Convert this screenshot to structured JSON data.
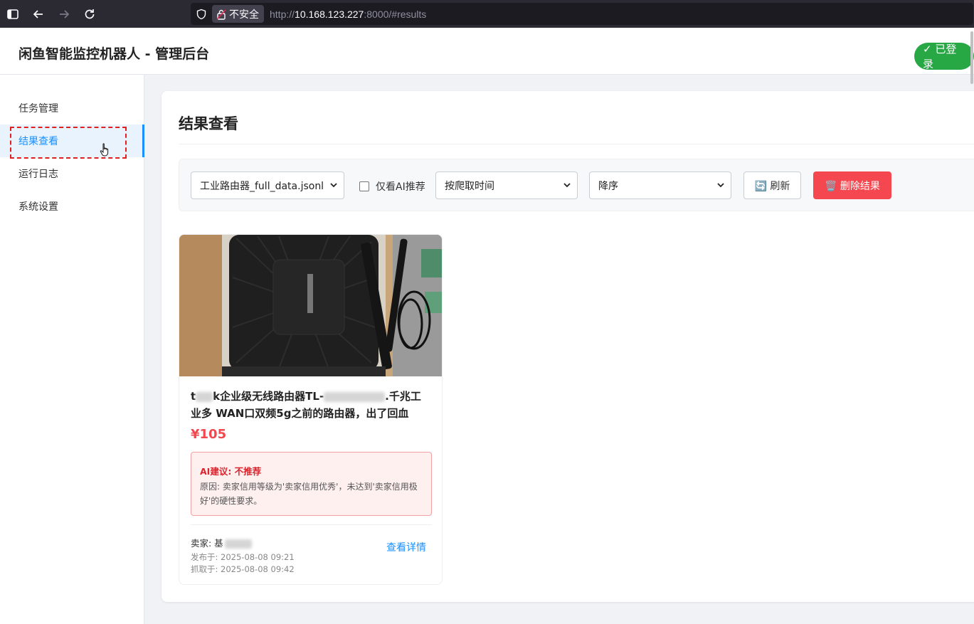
{
  "browser": {
    "security_label": "不安全",
    "url_prefix": "http://",
    "url_host": "10.168.123.227",
    "url_rest": ":8000/#results"
  },
  "header": {
    "title": "闲鱼智能监控机器人 - 管理后台",
    "login_status": "✓ 已登录"
  },
  "sidebar": {
    "items": [
      {
        "label": "任务管理",
        "active": false
      },
      {
        "label": "结果查看",
        "active": true
      },
      {
        "label": "运行日志",
        "active": false
      },
      {
        "label": "系统设置",
        "active": false
      }
    ]
  },
  "main": {
    "title": "结果查看",
    "toolbar": {
      "file_select": "工业路由器_full_data.jsonl",
      "ai_only_label": "仅看AI推荐",
      "ai_only_checked": false,
      "sort_field": "按爬取时间",
      "sort_order": "降序",
      "refresh_label": "🔄 刷新",
      "delete_label": "🗑️ 删除结果"
    },
    "results": [
      {
        "title_line1_a": "t",
        "title_line1_b": "k企业级无线路由器TL-",
        "title_line1_c": ".千兆工",
        "title_line2": "业多 WAN口双频5g之前的路由器，出了回血",
        "price": "¥105",
        "ai_verdict": "AI建议: 不推荐",
        "ai_reason": "原因: 卖家信用等级为'卖家信用优秀'，未达到'卖家信用极好'的硬性要求。",
        "seller_prefix": "卖家: 基",
        "published": "发布于: 2025-08-08 09:21",
        "fetched": "抓取于: 2025-08-08 09:42",
        "detail_link": "查看详情"
      }
    ]
  },
  "colors": {
    "accent": "#1890ff",
    "danger": "#f5474f",
    "success": "#28a745"
  }
}
